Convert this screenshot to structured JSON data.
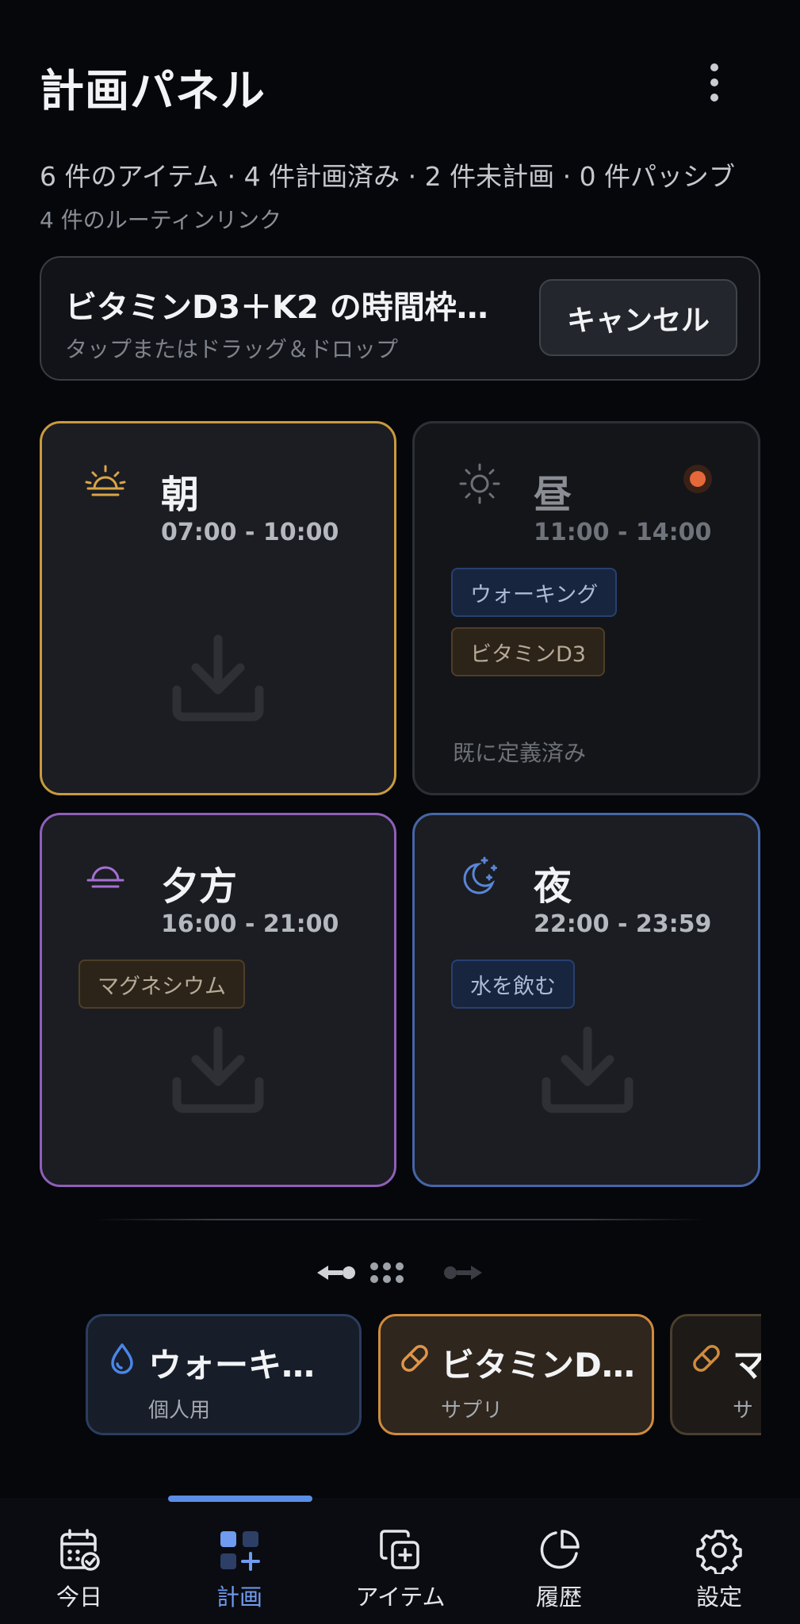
{
  "header": {
    "title": "計画パネル",
    "summary": "6 件のアイテム · 4 件計画済み · 2 件未計画 · 0 件パッシブ",
    "routines": "4 件のルーティンリンク"
  },
  "banner": {
    "title": "ビタミンD3＋K2 の時間枠…",
    "subtitle": "タップまたはドラッグ＆ドロップ",
    "cancel_label": "キャンセル"
  },
  "slots": {
    "morning": {
      "name": "朝",
      "time": "07:00 - 10:00",
      "icon": "sunrise-icon",
      "accent": "#c99a3e"
    },
    "noon": {
      "name": "昼",
      "time": "11:00 - 14:00",
      "icon": "sun-icon",
      "chips": [
        "ウォーキング",
        "ビタミンD3"
      ],
      "note": "既に定義済み",
      "accent": "#e4683a"
    },
    "evening": {
      "name": "夕方",
      "time": "16:00 - 21:00",
      "icon": "sunset-icon",
      "chips": [
        "マグネシウム"
      ],
      "accent": "#8f5fb8"
    },
    "night": {
      "name": "夜",
      "time": "22:00 - 23:59",
      "icon": "moon-stars-icon",
      "chips": [
        "水を飲む"
      ],
      "accent": "#4666a6"
    }
  },
  "carousel": {
    "items": [
      {
        "title": "ウォーキ…",
        "subtitle": "個人用",
        "icon": "drop-icon"
      },
      {
        "title": "ビタミンD…",
        "subtitle": "サプリ",
        "icon": "pill-icon"
      },
      {
        "title": "マ",
        "subtitle": "サ",
        "icon": "pill-icon"
      }
    ]
  },
  "nav": {
    "items": [
      {
        "label": "今日",
        "icon": "calendar-check-icon"
      },
      {
        "label": "計画",
        "icon": "grid-plus-icon",
        "active": true
      },
      {
        "label": "アイテム",
        "icon": "copy-plus-icon"
      },
      {
        "label": "履歴",
        "icon": "pie-chart-icon"
      },
      {
        "label": "設定",
        "icon": "gear-icon"
      }
    ]
  }
}
